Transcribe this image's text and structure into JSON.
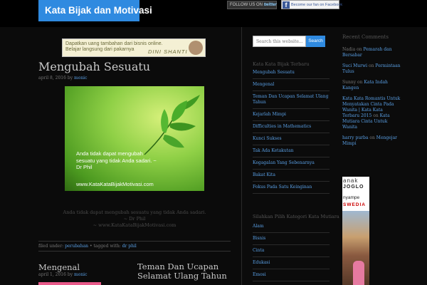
{
  "header": {
    "site_title": "Kata Bijak dan Motivasi",
    "twitter_prefix": "FOLLOW US ON",
    "twitter_brand": "twitter",
    "facebook_label": "Become our fan on Facebook"
  },
  "ad": {
    "text": "Dapatkan uang tambahan dari bisnis online. Belajar langsung dari pakarnya",
    "name": "DINI SHANTI"
  },
  "post": {
    "title": "Mengubah Sesuatu",
    "date": "april 8, 2016",
    "by": "by",
    "author": "monic",
    "image_quote": "Anda tidak dapat mengubah sesuatu yang tidak Anda sadari. ~ Dr Phil",
    "image_url": "www.KataKataBijakMotivasi.com",
    "caption_line1": "Anda tidak dapat mengubah sesuatu yang tidak Anda sadari.",
    "caption_line2": "~ Dr Phil",
    "caption_line3": "~ www.KataKataBijakMotivasi.com",
    "filed_label": "filed under:",
    "category": "perubahan",
    "tagged_label": "• tagged with:",
    "tag": "dr phil"
  },
  "mini_posts": [
    {
      "title": "Mengenal",
      "date": "april 1, 2016",
      "by": "by",
      "author": "monic"
    },
    {
      "title": "Teman Dan Ucapan Selamat Ulang Tahun"
    }
  ],
  "sidebar": {
    "search_placeholder": "Search this website...",
    "search_button": "Search",
    "widget1_title": "Kata Kata Bijak Terbaru",
    "recent_posts": [
      "Mengubah Sesuatu",
      "Mengenal",
      "Teman Dan Ucapan Selamat Ulang Tahun",
      "Kejarlah Mimpi",
      "Difficulties in Mathematics",
      "Kunci Sukses",
      "Tak Ada Ketakutan",
      "Kegagalan Yang Sebenarnya",
      "Bakat Kita",
      "Fokus Pada Satu Keinginan"
    ],
    "widget2_title": "Silahkan Pilih Kategori Kata Mutiara",
    "categories": [
      "Alam",
      "Bisnis",
      "Cinta",
      "Edukasi",
      "Emosi"
    ]
  },
  "recent_comments": {
    "title": "Recent Comments",
    "items": [
      {
        "author": "Nadia",
        "on": "on",
        "post": "Pemarah dan Bersabar"
      },
      {
        "author": "Suci Murwi",
        "on": "on",
        "post": "Permintaan Tulus"
      },
      {
        "author": "Sunny",
        "on": "on",
        "post": "Kata Indah Kangen"
      },
      {
        "author": "Kata Kata Romantis Untuk Menyatakan Cinta Pada Wanita | Kata Kata Terbaru 2015",
        "on": "on",
        "post": "Kata Mutiara Cinta Untuk Wanita"
      },
      {
        "author": "harry purba",
        "on": "on",
        "post": "Mengejar Mimpi"
      }
    ]
  },
  "promo": {
    "line1": "anak",
    "line2": "JOGLO",
    "line3": "nyampe",
    "line4": "SWEDIA"
  },
  "colors": {
    "accent": "#2f8ae0",
    "link": "#5aa0e6",
    "background": "#0b0b0b"
  }
}
